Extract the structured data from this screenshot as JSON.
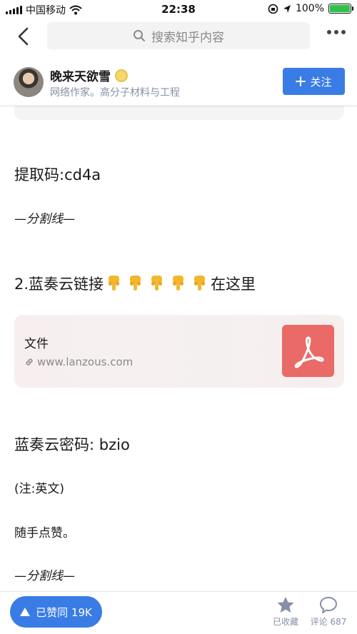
{
  "status_bar": {
    "carrier": "中国移动",
    "time": "22:38",
    "battery": "100%",
    "battery_level": 1.0
  },
  "nav": {
    "search_placeholder": "搜索知乎内容",
    "icons": [
      "back-icon",
      "search-icon",
      "more-icon"
    ]
  },
  "author": {
    "name": "晚来天欲雪",
    "bio": "网络作家。高分子材料与工程",
    "follow_label": "关注"
  },
  "article": {
    "code_line": "提取码:cd4a",
    "divider1": "—分割线—",
    "lanzou_heading_prefix": "2.蓝奏云链接",
    "lanzou_heading_suffix": "在这里",
    "finger_count": 5,
    "link_card": {
      "title": "文件",
      "url": "www.lanzous.com"
    },
    "password_line": "蓝奏云密码: bzio",
    "note": "(注:英文)",
    "like_hint": "随手点赞。",
    "divider2": "—分割线—"
  },
  "bottom": {
    "vote_label": "已赞同 19K",
    "collect_label": "已收藏",
    "comment_label": "评论 687"
  },
  "colors": {
    "accent": "#3a7ce6",
    "pdf": "#e96a66",
    "muted": "#8590a6",
    "battery": "#2fc24a"
  }
}
